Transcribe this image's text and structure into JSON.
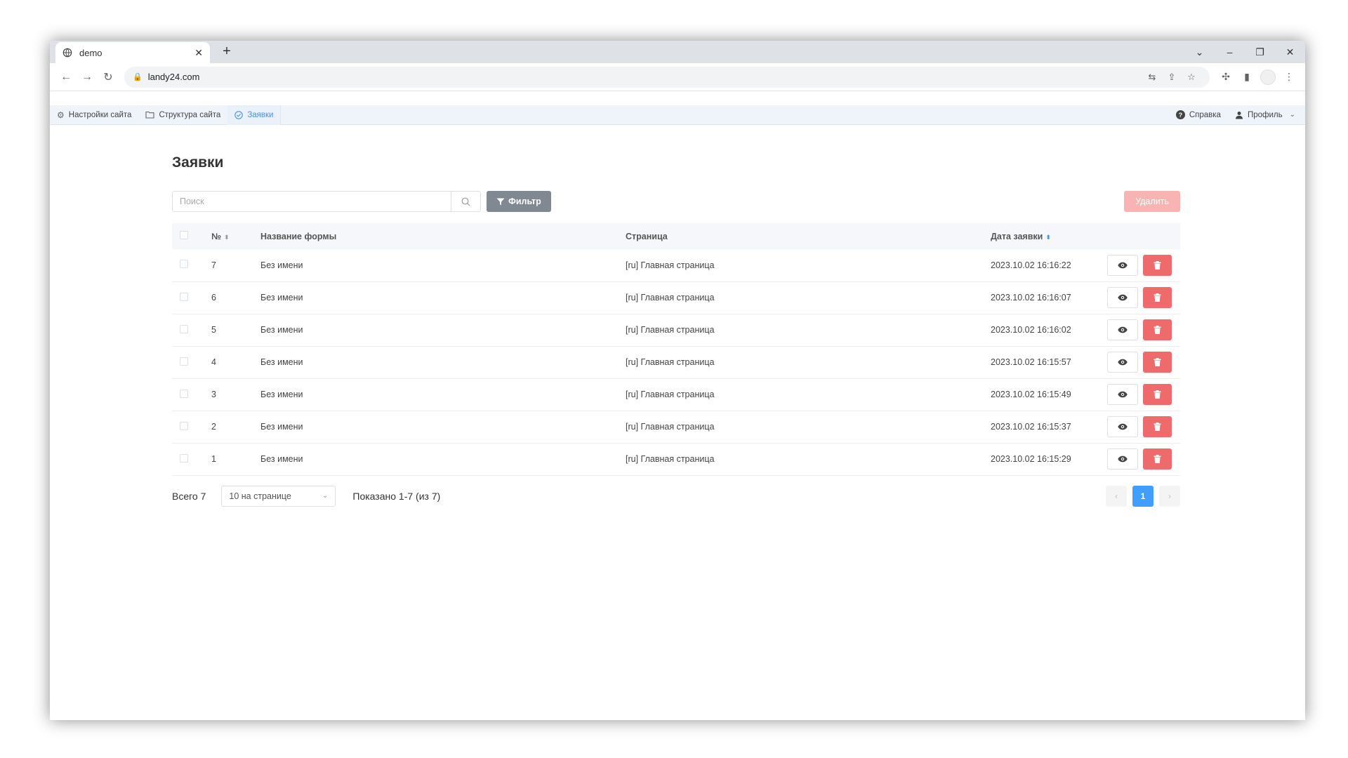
{
  "browser": {
    "tab_title": "demo",
    "new_tab": "+",
    "tab_close": "✕",
    "url": "landy24.com",
    "window_controls": [
      "⌄",
      "–",
      "❐",
      "✕"
    ]
  },
  "appnav": {
    "items": [
      {
        "label": "Настройки сайта",
        "icon": "gear-icon"
      },
      {
        "label": "Структура сайта",
        "icon": "folder-icon"
      },
      {
        "label": "Заявки",
        "icon": "check-circle-icon"
      }
    ],
    "help_label": "Справка",
    "profile_label": "Профиль"
  },
  "page": {
    "title": "Заявки",
    "search_placeholder": "Поиск",
    "filter_label": "Фильтр",
    "delete_label": "Удалить"
  },
  "table": {
    "headers": {
      "num": "№",
      "form_name": "Название формы",
      "page": "Страница",
      "date": "Дата заявки"
    },
    "rows": [
      {
        "num": "7",
        "form_name": "Без имени",
        "page": "[ru] Главная страница",
        "date": "2023.10.02 16:16:22"
      },
      {
        "num": "6",
        "form_name": "Без имени",
        "page": "[ru] Главная страница",
        "date": "2023.10.02 16:16:07"
      },
      {
        "num": "5",
        "form_name": "Без имени",
        "page": "[ru] Главная страница",
        "date": "2023.10.02 16:16:02"
      },
      {
        "num": "4",
        "form_name": "Без имени",
        "page": "[ru] Главная страница",
        "date": "2023.10.02 16:15:57"
      },
      {
        "num": "3",
        "form_name": "Без имени",
        "page": "[ru] Главная страница",
        "date": "2023.10.02 16:15:49"
      },
      {
        "num": "2",
        "form_name": "Без имени",
        "page": "[ru] Главная страница",
        "date": "2023.10.02 16:15:37"
      },
      {
        "num": "1",
        "form_name": "Без имени",
        "page": "[ru] Главная страница",
        "date": "2023.10.02 16:15:29"
      }
    ]
  },
  "footer": {
    "total": "Всего 7",
    "per_page": "10 на странице",
    "shown": "Показано 1-7 (из 7)",
    "prev": "‹",
    "current_page": "1",
    "next": "›"
  },
  "colors": {
    "accent": "#409eff",
    "danger": "#ef6b6b",
    "danger_disabled": "#f8b3b3",
    "filter": "#808891",
    "nav_bg": "#eff4fb"
  }
}
